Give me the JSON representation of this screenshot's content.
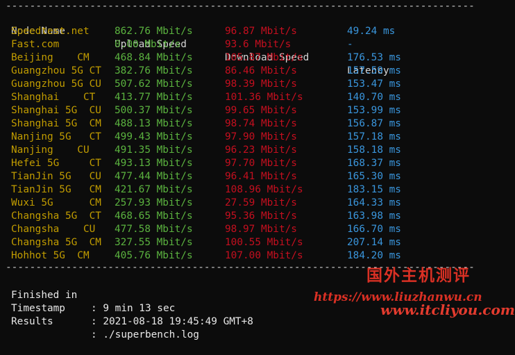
{
  "separator": "------------------------------------------------------------------------------",
  "headers": {
    "node": "Node Name",
    "upload": "Upload Speed",
    "download": "Download Speed",
    "latency": "Latency"
  },
  "rows": [
    {
      "node": "Speedtest.net",
      "upload": "862.76 Mbit/s",
      "download": "96.87 Mbit/s",
      "latency": "49.24 ms"
    },
    {
      "node": "Fast.com",
      "upload": "0.00 Mbit/s",
      "download": "93.6 Mbit/s",
      "latency": "-"
    },
    {
      "node": "Beijing    CM",
      "upload": "468.84 Mbit/s",
      "download": "105.87 Mbit/s",
      "latency": "176.53 ms"
    },
    {
      "node": "Guangzhou 5G CT",
      "upload": "382.76 Mbit/s",
      "download": "86.46 Mbit/s",
      "latency": "157.59 ms"
    },
    {
      "node": "Guangzhou 5G CU",
      "upload": "507.62 Mbit/s",
      "download": "98.39 Mbit/s",
      "latency": "153.47 ms"
    },
    {
      "node": "Shanghai    CT",
      "upload": "413.77 Mbit/s",
      "download": "101.36 Mbit/s",
      "latency": "140.70 ms"
    },
    {
      "node": "Shanghai 5G  CU",
      "upload": "500.37 Mbit/s",
      "download": "99.65 Mbit/s",
      "latency": "153.99 ms"
    },
    {
      "node": "Shanghai 5G  CM",
      "upload": "488.13 Mbit/s",
      "download": "98.74 Mbit/s",
      "latency": "156.87 ms"
    },
    {
      "node": "Nanjing 5G   CT",
      "upload": "499.43 Mbit/s",
      "download": "97.90 Mbit/s",
      "latency": "157.18 ms"
    },
    {
      "node": "Nanjing    CU",
      "upload": "491.35 Mbit/s",
      "download": "96.23 Mbit/s",
      "latency": "158.18 ms"
    },
    {
      "node": "Hefei 5G     CT",
      "upload": "493.13 Mbit/s",
      "download": "97.70 Mbit/s",
      "latency": "168.37 ms"
    },
    {
      "node": "TianJin 5G   CU",
      "upload": "477.44 Mbit/s",
      "download": "96.41 Mbit/s",
      "latency": "165.30 ms"
    },
    {
      "node": "TianJin 5G   CM",
      "upload": "421.67 Mbit/s",
      "download": "108.96 Mbit/s",
      "latency": "183.15 ms"
    },
    {
      "node": "Wuxi 5G      CM",
      "upload": "257.93 Mbit/s",
      "download": "27.59 Mbit/s",
      "latency": "164.33 ms"
    },
    {
      "node": "Changsha 5G  CT",
      "upload": "468.65 Mbit/s",
      "download": "95.36 Mbit/s",
      "latency": "163.98 ms"
    },
    {
      "node": "Changsha    CU",
      "upload": "477.58 Mbit/s",
      "download": "98.97 Mbit/s",
      "latency": "166.70 ms"
    },
    {
      "node": "Changsha 5G  CM",
      "upload": "327.55 Mbit/s",
      "download": "100.55 Mbit/s",
      "latency": "207.14 ms"
    },
    {
      "node": "Hohhot 5G  CM",
      "upload": "405.76 Mbit/s",
      "download": "107.00 Mbit/s",
      "latency": "184.20 ms"
    }
  ],
  "summary": [
    {
      "label": "Finished in",
      "value": ": 9 min 13 sec"
    },
    {
      "label": "Timestamp",
      "value": ": 2021-08-18 19:45:49 GMT+8"
    },
    {
      "label": "Results",
      "value": ": ./superbench.log"
    }
  ],
  "watermark": {
    "title": "国外主机测评",
    "url": "https://www.liuzhanwu.cn",
    "url2": "www.itcliyou.com"
  },
  "colors": {
    "background": "#0c0c0c",
    "node": "#c19c00",
    "upload": "#5bb33f",
    "download": "#c50f1f",
    "latency": "#3a96dd",
    "watermark": "#d93024"
  }
}
